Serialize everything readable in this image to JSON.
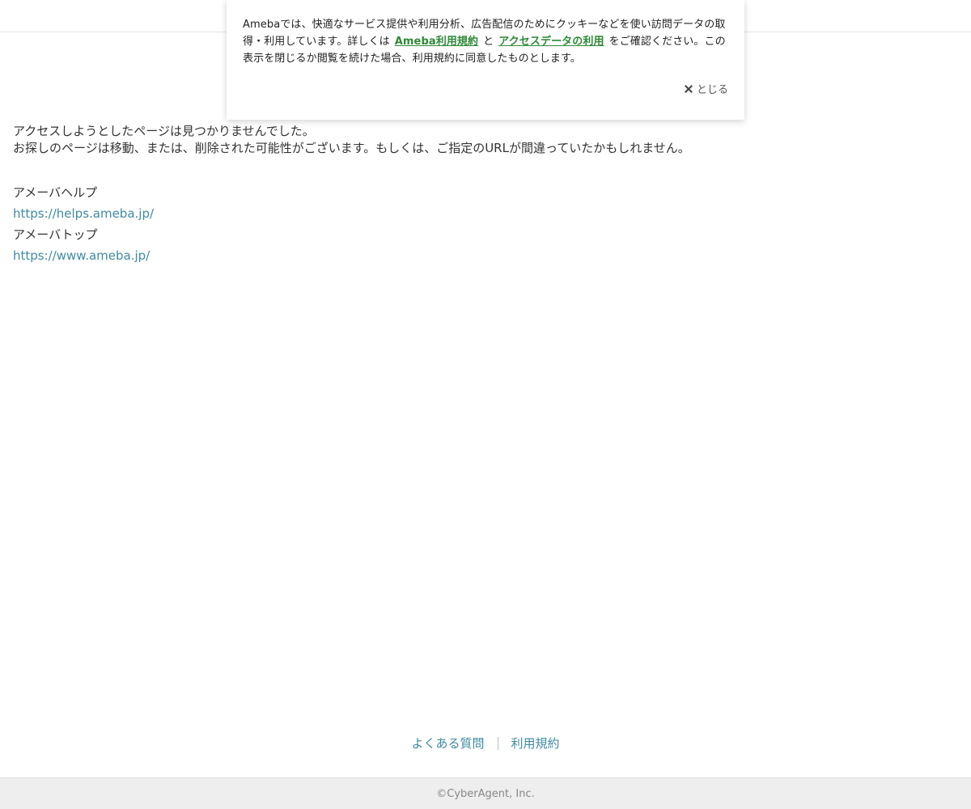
{
  "cookie_banner": {
    "text_before": "Amebaでは、快適なサービス提供や利用分析、広告配信のためにクッキーなどを使い訪問データの取得・利用しています。詳しくは",
    "terms_link": "Ameba利用規約",
    "connector": "と",
    "access_data_link": "アクセスデータの利用",
    "text_after": "をご確認ください。この表示を閉じるか閲覧を続けた場合、利用規約に同意したものとします。",
    "close_label": "とじる",
    "link_color": "#2d8a36"
  },
  "main": {
    "message_line1": "アクセスしようとしたページは見つかりませんでした。",
    "message_line2": "お探しのページは移動、または、削除された可能性がございます。もしくは、ご指定のURLが間違っていたかもしれません。",
    "links": [
      {
        "label": "アメーバヘルプ",
        "url": "https://helps.ameba.jp/"
      },
      {
        "label": "アメーバトップ",
        "url": "https://www.ameba.jp/"
      }
    ],
    "link_color": "#3f8ba3"
  },
  "footer": {
    "links": [
      "よくある質問",
      "利用規約"
    ],
    "copyright": "©CyberAgent, Inc."
  }
}
